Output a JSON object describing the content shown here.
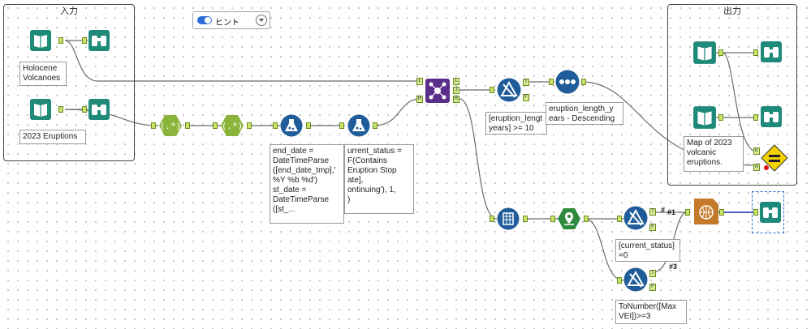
{
  "containers": {
    "input_title": "入力",
    "output_title": "出力"
  },
  "hint": {
    "label": "ヒント"
  },
  "notes": {
    "holocene": "Holocene\nVolcanoes",
    "eruptions2023": "2023 Eruptions",
    "formula1": "end_date =\nDateTimeParse\n([end_date_tmp],'\n%Y %b %d')\nst_date =\nDateTimeParse\n([st_...",
    "formula2": "urrent_status =\nF(Contains\nEruption Stop\nate],\nontinuing'), 1,\n)",
    "filter1": "[eruption_lengt\nyears] >= 10",
    "sort": "eruption_length_y\nears - Descending",
    "filter2": "[current_status]\n=0",
    "filter3": "ToNumber([Max\nVEI])>=3",
    "map_output": "Map of 2023\nvolcanic\neruptions."
  },
  "labels": {
    "hash1": "#1",
    "hash3": "#3",
    "hash_s": "#"
  },
  "anchors": {
    "L": "L",
    "J": "J",
    "R": "R",
    "T": "T",
    "F": "F",
    "E": "E",
    "A": "A"
  },
  "colors": {
    "input_tool": "#1f8a7a",
    "browse_tool": "#1f8a7a",
    "regex_tool": "#8ab43a",
    "formula_tool": "#1f5c99",
    "join_tool": "#5a2f8c",
    "filter_tool": "#1f5c99",
    "sort_tool": "#1f5c99",
    "spatial_tool": "#2e8b3e",
    "render_tool": "#c47a2a",
    "test_tool": "#f0d000",
    "wire": "#666666",
    "wire_selected": "#1a2ea8"
  }
}
